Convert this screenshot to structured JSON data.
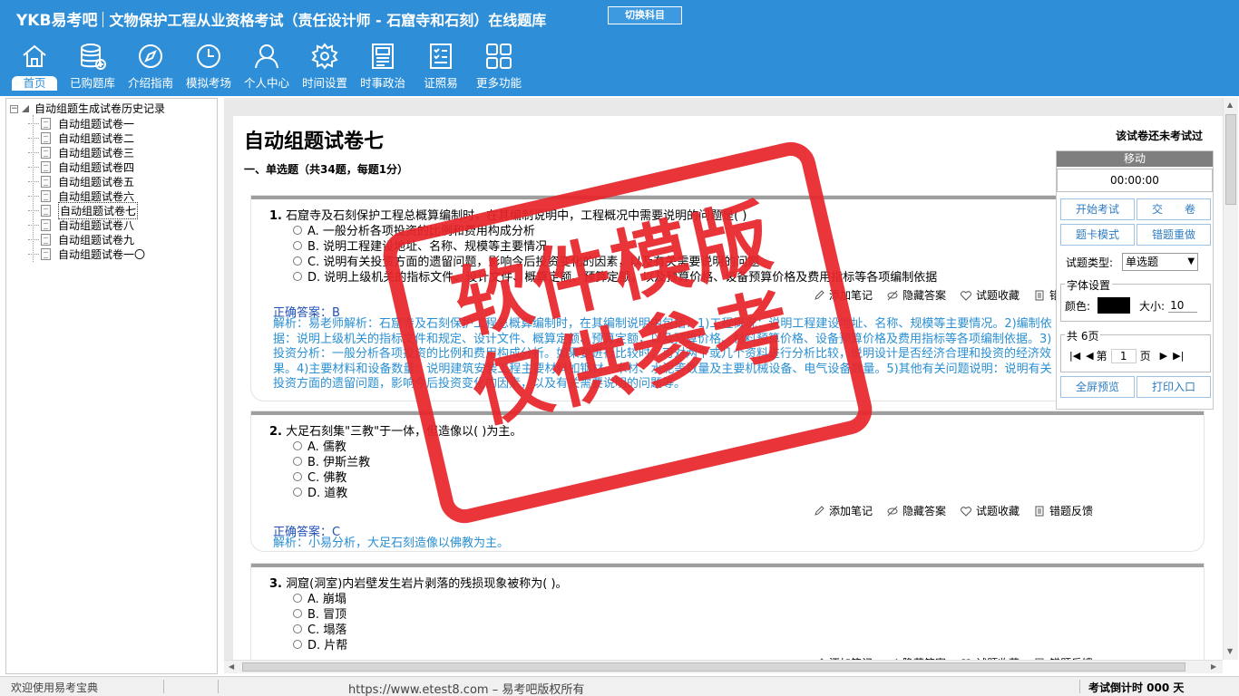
{
  "app": {
    "brand": "YKB易考吧",
    "title": "文物保护工程从业资格考试（责任设计师 - 石窟寺和石刻）在线题库",
    "switch_label": "切换科目"
  },
  "toolbar": [
    {
      "label": "首页",
      "icon": "home-icon"
    },
    {
      "label": "已购题库",
      "icon": "database-icon"
    },
    {
      "label": "介绍指南",
      "icon": "compass-icon"
    },
    {
      "label": "模拟考场",
      "icon": "clock-icon"
    },
    {
      "label": "个人中心",
      "icon": "user-icon"
    },
    {
      "label": "时间设置",
      "icon": "gear-icon"
    },
    {
      "label": "时事政治",
      "icon": "newspaper-icon"
    },
    {
      "label": "证照易",
      "icon": "checklist-icon"
    },
    {
      "label": "更多功能",
      "icon": "grid-icon"
    }
  ],
  "tree": {
    "root": "自动组题生成试卷历史记录",
    "items": [
      "自动组题试卷一",
      "自动组题试卷二",
      "自动组题试卷三",
      "自动组题试卷四",
      "自动组题试卷五",
      "自动组题试卷六",
      "自动组题试卷七",
      "自动组题试卷八",
      "自动组题试卷九",
      "自动组题试卷一〇"
    ],
    "selected_index": 6
  },
  "paper": {
    "title": "自动组题试卷七",
    "status": "该试卷还未考试过",
    "section": "一、单选题（共34题，每题1分）"
  },
  "actions": {
    "note": "添加笔记",
    "hide": "隐藏答案",
    "fav": "试题收藏",
    "report": "错题反馈"
  },
  "questions": [
    {
      "num": "1.",
      "text": "石窟寺及石刻保护工程总概算编制时，在其编制说明中，工程概况中需要说明的问题是(  )",
      "options": [
        "A. 一般分析各项投资的比例和费用构成分析",
        "B. 说明工程建设地址、名称、规模等主要情况",
        "C. 说明有关投资方面的遗留问题，影响今后投资变化的因素，以及有关需要说明的问题",
        "D. 说明上级机关的指标文件、设计文件、概算定额、预算定额，以及预算价格、设备预算价格及费用指标等各项编制依据"
      ],
      "answer_label": "正确答案：",
      "answer": "B",
      "analysis": "解析：易老师解析：石窟寺及石刻保护工程总概算编制时，在其编制说明中包括：1)工程概况：说明工程建设地址、名称、规模等主要情况。2)编制依据：说明上级机关的指标文件和规定、设计文件、概算定额、预算定额，以及预算价格、材料预算价格、设备预算价格及费用指标等各项编制依据。3)投资分析：一般分析各项投资的比例和费用构成分析。如果要进行比较时，可对两个或几个资料进行分析比较，说明设计是否经济合理和投资的经济效果。4)主要材料和设备数量：说明建筑安装工程主要材料如钢材、木材、水泥等数量及主要机械设备、电气设备数量。5)其他有关问题说明：说明有关投资方面的遗留问题，影响今后投资变化的因素，以及有关需要说明的问题等。"
    },
    {
      "num": "2.",
      "text": "大足石刻集\"三教\"于一体，但造像以(  )为主。",
      "options": [
        "A. 儒教",
        "B. 伊斯兰教",
        "C. 佛教",
        "D. 道教"
      ],
      "answer_label": "正确答案：",
      "answer": "C",
      "analysis": "解析：小易分析，大足石刻造像以佛教为主。"
    },
    {
      "num": "3.",
      "text": "洞窟(洞室)内岩壁发生岩片剥落的残损现象被称为(  )。",
      "options": [
        "A. 崩塌",
        "B. 冒顶",
        "C. 塌落",
        "D. 片帮"
      ]
    }
  ],
  "panel": {
    "move": "移动",
    "timer": "00:00:00",
    "start": "开始考试",
    "submit": "交　　卷",
    "card_mode": "题卡模式",
    "redo_wrong": "错题重做",
    "type_label": "试题类型:",
    "type_value": "单选题",
    "font_legend": "字体设置",
    "color_label": "颜色:",
    "color_value": "#000000",
    "size_label": "大小:",
    "size_value": "10",
    "pages_legend": "共 6页",
    "page_prefix": "第",
    "page_value": "1",
    "page_suffix": "页",
    "fullscreen": "全屏预览",
    "print": "打印入口"
  },
  "status": {
    "welcome": "欢迎使用易考宝典",
    "url": "https://www.etest8.com – 易考吧版权所有",
    "countdown": "考试倒计时 000 天"
  },
  "watermark": {
    "line1": "软件模版",
    "line2": "仅供参考"
  },
  "colors": {
    "header_blue": "#2e8fd8",
    "answer_blue": "#1f4fb8",
    "analysis_blue": "#2a8fd2",
    "stamp_red": "#e8262b"
  }
}
